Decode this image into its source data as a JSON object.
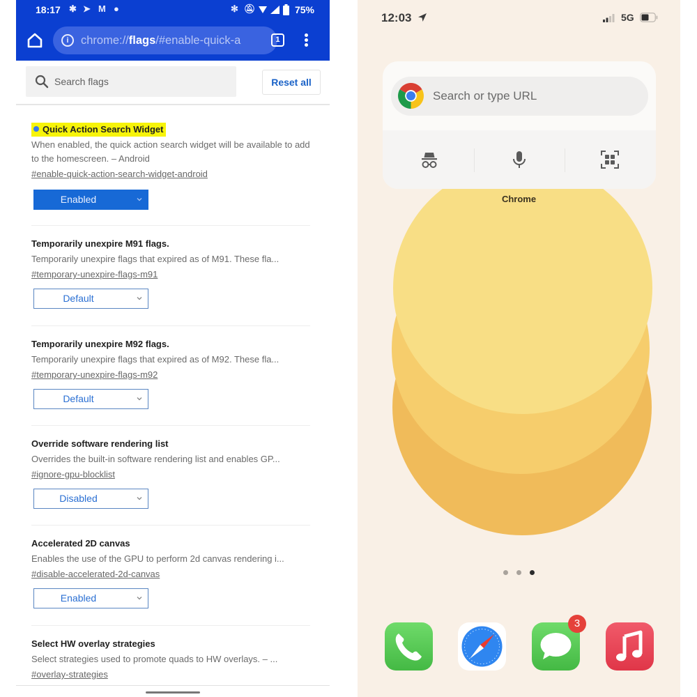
{
  "android": {
    "status_bar": {
      "time": "18:17",
      "left_icons": [
        "slack-icon",
        "telegram-icon",
        "gmail-icon",
        "football-icon"
      ],
      "right_icons": [
        "bluetooth-icon",
        "notifications-off-icon",
        "wifi-icon",
        "cell-signal-icon",
        "battery-icon"
      ],
      "battery": "75%"
    },
    "toolbar": {
      "url_scheme": "chrome://",
      "url_host": "flags",
      "url_rest": "/#enable-quick-a",
      "tab_count": "1"
    },
    "search": {
      "placeholder": "Search flags",
      "value": "",
      "reset_label": "Reset all"
    },
    "flags": [
      {
        "title": "Quick Action Search Widget",
        "description": "When enabled, the quick action search widget will be available to add to the homescreen. – Android",
        "link": "#enable-quick-action-search-widget-android",
        "value": "Enabled",
        "highlighted": true
      },
      {
        "title": "Temporarily unexpire M91 flags.",
        "description": "Temporarily unexpire flags that expired as of M91. These fla...",
        "link": "#temporary-unexpire-flags-m91",
        "value": "Default"
      },
      {
        "title": "Temporarily unexpire M92 flags.",
        "description": "Temporarily unexpire flags that expired as of M92. These fla...",
        "link": "#temporary-unexpire-flags-m92",
        "value": "Default"
      },
      {
        "title": "Override software rendering list",
        "description": "Overrides the built-in software rendering list and enables GP...",
        "link": "#ignore-gpu-blocklist",
        "value": "Disabled"
      },
      {
        "title": "Accelerated 2D canvas",
        "description": "Enables the use of the GPU to perform 2d canvas rendering i...",
        "link": "#disable-accelerated-2d-canvas",
        "value": "Enabled"
      },
      {
        "title": "Select HW overlay strategies",
        "description": "Select strategies used to promote quads to HW overlays. – ...",
        "link": "#overlay-strategies"
      }
    ],
    "colors": {
      "header": "#0b3fd1",
      "highlight": "#f7f40a",
      "enabled_select": "#1769d6",
      "link_blue": "#1a62c7"
    }
  },
  "ios": {
    "status_bar": {
      "time": "12:03",
      "network": "5G"
    },
    "widget": {
      "search_placeholder": "Search or type URL",
      "actions": [
        "incognito-icon",
        "microphone-icon",
        "qr-scanner-icon"
      ],
      "app_label": "Chrome"
    },
    "pager": {
      "pages": 3,
      "current": 3
    },
    "dock": [
      {
        "name": "Phone",
        "icon": "phone-icon"
      },
      {
        "name": "Safari",
        "icon": "safari-icon"
      },
      {
        "name": "Messages",
        "icon": "messages-icon",
        "badge": "3"
      },
      {
        "name": "Music",
        "icon": "music-icon"
      }
    ],
    "colors": {
      "background": "#f9f0e6",
      "blob_light": "#f8de85",
      "blob_mid": "#f6cd6c",
      "blob_dark": "#f0bb5a"
    }
  }
}
